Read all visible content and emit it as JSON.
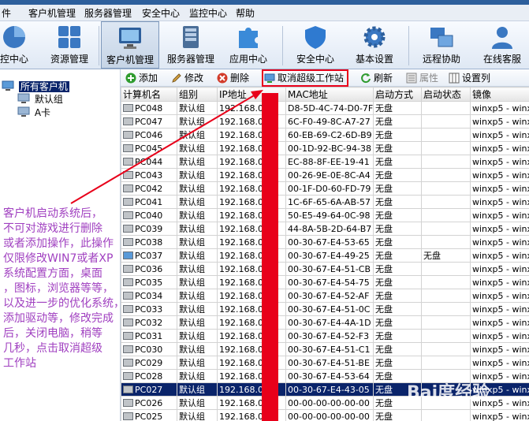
{
  "menubar": {
    "items": [
      "件",
      "客户机管理",
      "服务器管理",
      "安全中心",
      "监控中心",
      "帮助"
    ]
  },
  "toolbar": {
    "items": [
      {
        "label": "控中心",
        "icon": "pie-chart-icon"
      },
      {
        "label": "资源管理",
        "icon": "grid-icon"
      },
      {
        "label": "客户机管理",
        "icon": "monitor-icon",
        "active": true
      },
      {
        "label": "服务器管理",
        "icon": "server-icon"
      },
      {
        "label": "应用中心",
        "icon": "puzzle-icon"
      },
      {
        "label": "安全中心",
        "icon": "shield-icon"
      },
      {
        "label": "基本设置",
        "icon": "gear-icon"
      },
      {
        "label": "远程协助",
        "icon": "remote-windows-icon"
      },
      {
        "label": "在线客服",
        "icon": "user-icon"
      }
    ]
  },
  "tree": {
    "root": "所有客户机",
    "children": [
      "默认组",
      "A卡"
    ]
  },
  "actions": {
    "add": "添加",
    "edit": "修改",
    "delete": "删除",
    "cancel_super": "取消超级工作站",
    "refresh": "刷新",
    "props": "属性",
    "columns": "设置列"
  },
  "grid": {
    "headers": [
      "计算机名",
      "组别",
      "IP地址",
      "MAC地址",
      "启动方式",
      "启动状态",
      "镜像"
    ],
    "rows": [
      [
        "PC048",
        "默认组",
        "192.168.0.",
        "D8-5D-4C-74-D0-7F",
        "无盘",
        "",
        "winxp5 - winx"
      ],
      [
        "PC047",
        "默认组",
        "192.168.0.",
        "6C-F0-49-8C-A7-27",
        "无盘",
        "",
        "winxp5 - winx"
      ],
      [
        "PC046",
        "默认组",
        "192.168.0.",
        "60-EB-69-C2-6D-B9",
        "无盘",
        "",
        "winxp5 - winx"
      ],
      [
        "PC045",
        "默认组",
        "192.168.0.",
        "00-1D-92-BC-94-38",
        "无盘",
        "",
        "winxp5 - winx"
      ],
      [
        "PC044",
        "默认组",
        "192.168.0.",
        "EC-88-8F-EE-19-41",
        "无盘",
        "",
        "winxp5 - winx"
      ],
      [
        "PC043",
        "默认组",
        "192.168.0.",
        "00-26-9E-0E-8C-A4",
        "无盘",
        "",
        "winxp5 - winx"
      ],
      [
        "PC042",
        "默认组",
        "192.168.0.",
        "00-1F-D0-60-FD-79",
        "无盘",
        "",
        "winxp5 - winx"
      ],
      [
        "PC041",
        "默认组",
        "192.168.0.",
        "1C-6F-65-6A-AB-57",
        "无盘",
        "",
        "winxp5 - winx"
      ],
      [
        "PC040",
        "默认组",
        "192.168.0.",
        "50-E5-49-64-0C-98",
        "无盘",
        "",
        "winxp5 - winx"
      ],
      [
        "PC039",
        "默认组",
        "192.168.0.",
        "44-8A-5B-2D-64-B7",
        "无盘",
        "",
        "winxp5 - winx"
      ],
      [
        "PC038",
        "默认组",
        "192.168.0.",
        "00-30-67-E4-53-65",
        "无盘",
        "",
        "winxp5 - winx"
      ],
      [
        "PC037",
        "默认组",
        "192.168.0.",
        "00-30-67-E4-49-25",
        "无盘",
        "无盘",
        "winxp5 - winx"
      ],
      [
        "PC036",
        "默认组",
        "192.168.0.",
        "00-30-67-E4-51-CB",
        "无盘",
        "",
        "winxp5 - winx"
      ],
      [
        "PC035",
        "默认组",
        "192.168.0.",
        "00-30-67-E4-54-75",
        "无盘",
        "",
        "winxp5 - winx"
      ],
      [
        "PC034",
        "默认组",
        "192.168.0.",
        "00-30-67-E4-52-AF",
        "无盘",
        "",
        "winxp5 - winx"
      ],
      [
        "PC033",
        "默认组",
        "192.168.0.",
        "00-30-67-E4-51-0C",
        "无盘",
        "",
        "winxp5 - winx"
      ],
      [
        "PC032",
        "默认组",
        "192.168.0.",
        "00-30-67-E4-4A-1D",
        "无盘",
        "",
        "winxp5 - winx"
      ],
      [
        "PC031",
        "默认组",
        "192.168.0.",
        "00-30-67-E4-52-F3",
        "无盘",
        "",
        "winxp5 - winx"
      ],
      [
        "PC030",
        "默认组",
        "192.168.0.",
        "00-30-67-E4-51-C1",
        "无盘",
        "",
        "winxp5 - winx"
      ],
      [
        "PC029",
        "默认组",
        "192.168.0.",
        "00-30-67-E4-51-BE",
        "无盘",
        "",
        "winxp5 - winx"
      ],
      [
        "PC028",
        "默认组",
        "192.168.0.",
        "00-30-67-E4-53-64",
        "无盘",
        "",
        "winxp5 - winx"
      ],
      [
        "PC027",
        "默认组",
        "192.168.0.",
        "00-30-67-E4-43-05",
        "无盘",
        "",
        "winxp5 - winx"
      ],
      [
        "PC026",
        "默认组",
        "192.168.0.",
        "00-00-00-00-00-00",
        "无盘",
        "",
        "winxp5 - winx"
      ],
      [
        "PC025",
        "默认组",
        "192.168.0.",
        "00-00-00-00-00-00",
        "无盘",
        "",
        "winxp5 - winx"
      ]
    ],
    "selected_row": 21,
    "online_row": 11
  },
  "annotation": {
    "text": "客户机启动系统后，\n不可对游戏进行删除\n或者添加操作，此操作\n仅限修改WIN7或者XP\n系统配置方面，桌面\n，图标，浏览器等等，\n以及进一步的优化系统，\n添加驱动等，修改完成\n后，关闭电脑，稍等\n几秒，点击取消超级\n工作站"
  },
  "watermark": "Bai度经验",
  "colors": {
    "selection": "#0a246a",
    "annotation_red": "#e8001a",
    "annotation_text": "#a040c0",
    "titlebar": "#2d5f9c"
  }
}
